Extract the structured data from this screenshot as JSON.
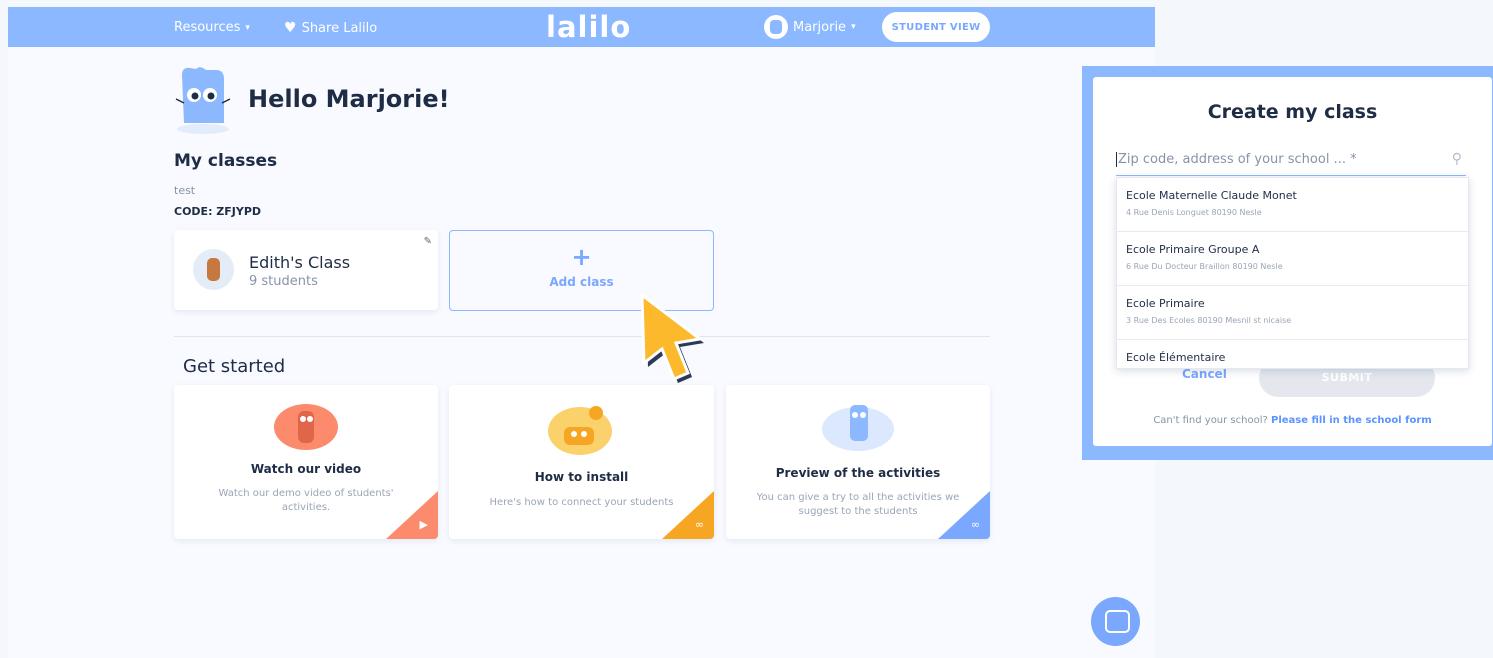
{
  "topbar": {
    "resources_label": "Resources",
    "share_label": "Share Lalilo",
    "logo": "lalilo",
    "user_label": "Marjorie",
    "student_view_label": "STUDENT VIEW"
  },
  "greeting": "Hello Marjorie!",
  "classes": {
    "heading": "My classes",
    "group_name": "test",
    "code_text": "CODE: ZFJYPD",
    "cards": [
      {
        "name": "Edith's Class",
        "count": "9 students"
      }
    ],
    "add_label": "Add class"
  },
  "get_started": {
    "heading": "Get started",
    "cards": [
      {
        "title": "Watch our video",
        "desc": "Watch our demo video of students' activities.",
        "color": "#fb8b6c",
        "icon": "play-icon"
      },
      {
        "title": "How to install",
        "desc": "Here's how to connect your students",
        "color": "#f6a623",
        "icon": "link-icon"
      },
      {
        "title": "Preview of the activities",
        "desc": "You can give a try to all the activities we suggest to the students",
        "color": "#7aa8ff",
        "icon": "link-icon"
      }
    ]
  },
  "modal": {
    "title": "Create my class",
    "search_placeholder": "Zip code, address of your school ... *",
    "schools": [
      {
        "name": "Ecole Maternelle Claude Monet",
        "address": "4 Rue Denis Longuet 80190 Nesle"
      },
      {
        "name": "Ecole Primaire Groupe A",
        "address": "6 Rue Du Docteur Braillon 80190 Nesle"
      },
      {
        "name": "Ecole Primaire",
        "address": "3 Rue Des Ecoles 80190 Mesnil st nicaise"
      },
      {
        "name": "Ecole Élémentaire",
        "address": ""
      }
    ],
    "cancel_label": "Cancel",
    "submit_label": "SUBMIT",
    "footnote_text": "Can't find your school?",
    "footnote_link": "Please fill in the school form"
  },
  "colors": {
    "brand": "#8bb8ff",
    "accent": "#7aa8ff"
  }
}
